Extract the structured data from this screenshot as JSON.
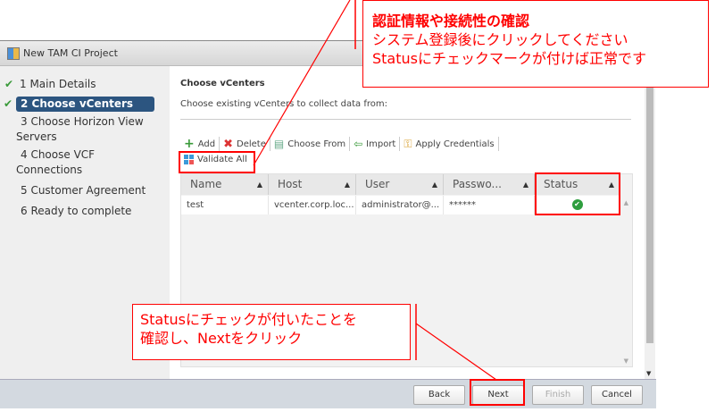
{
  "window": {
    "title": "New TAM CI Project"
  },
  "steps": [
    {
      "label": "1 Main Details",
      "done": true
    },
    {
      "label": "2 Choose vCenters",
      "done": true,
      "active": true
    },
    {
      "label": "3 Choose Horizon View Servers",
      "done": false
    },
    {
      "label": "4 Choose VCF Connections",
      "done": false
    },
    {
      "label": "5 Customer Agreement",
      "done": false
    },
    {
      "label": "6 Ready to complete",
      "done": false
    }
  ],
  "main": {
    "heading": "Choose vCenters",
    "subtitle": "Choose existing vCenters to collect data from:",
    "toolbar": {
      "add": "Add",
      "delete": "Delete",
      "choose_from": "Choose From",
      "import": "Import",
      "apply_credentials": "Apply Credentials",
      "validate_all": "Validate All"
    },
    "table": {
      "columns": [
        "Name",
        "Host",
        "User",
        "Passwo...",
        "Status"
      ],
      "rows": [
        {
          "name": "test",
          "host": "vcenter.corp.loc...",
          "user": "administrator@...",
          "password": "******",
          "status": "ok"
        }
      ]
    }
  },
  "footer": {
    "back": "Back",
    "next": "Next",
    "finish": "Finish",
    "cancel": "Cancel"
  },
  "annotations": {
    "top": {
      "title": "認証情報や接続性の確認",
      "line1": "システム登録後にクリックしてください",
      "line2": "Statusにチェックマークが付けば正常です"
    },
    "bottom": {
      "line1": "Statusにチェックが付いたことを",
      "line2": "確認し、Nextをクリック"
    }
  },
  "colors": {
    "accent": "#2c5580",
    "annotation": "#ff0000",
    "ok": "#2e9e3e"
  }
}
